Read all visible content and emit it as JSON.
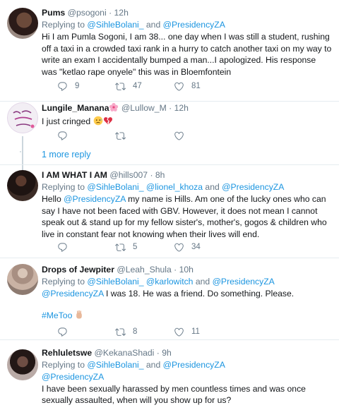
{
  "tweets": [
    {
      "name": "Pums",
      "handle": "@psogoni",
      "dot": "·",
      "time": "12h",
      "reply_prefix": "Replying to ",
      "reply_mentions": [
        "@SihleBolani_",
        "@PresidencyZA"
      ],
      "reply_and": " and ",
      "text": "Hi I am Pumla Sogoni, I am 38... one day when I was still a student, rushing off a taxi in a crowded taxi rank in a hurry to catch another taxi on my way to write an exam I accidentally bumped a  man...I apologized. His response was \"ketlao rape onyele\" this was in Bloemfontein",
      "replies": "9",
      "retweets": "47",
      "likes": "81"
    },
    {
      "name": "Lungile_Manana",
      "handle": "@Lullow_M",
      "dot": "·",
      "time": "12h",
      "text": "I just cringed",
      "more_replies": "1 more reply"
    },
    {
      "name": "I AM WHAT I AM",
      "handle": "@hills007",
      "dot": "·",
      "time": "8h",
      "reply_prefix": "Replying to ",
      "reply_mentions": [
        "@SihleBolani_",
        "@lionel_khoza",
        "@PresidencyZA"
      ],
      "reply_and": " and ",
      "text_hello": "Hello ",
      "text_mention": "@PresidencyZA",
      "text_rest": " my name is Hills. Am one of the lucky ones who can say I have not been faced with GBV. However, it does not mean I cannot speak out & stand up for my fellow sister's, mother's, gogos & children who live in constant fear not knowing when their lives will end.",
      "retweets": "5",
      "likes": "34"
    },
    {
      "name": "Drops of Jewpiter",
      "handle": "@Leah_Shula",
      "dot": "·",
      "time": "10h",
      "reply_prefix": "Replying to ",
      "reply_mentions": [
        "@SihleBolani_",
        "@karlowitch",
        "@PresidencyZA"
      ],
      "reply_and": " and ",
      "text_mention": "@PresidencyZA",
      "text_rest": " I was 18. He was a friend. Do something. Please.",
      "hashtag": "#MeToo",
      "retweets": "8",
      "likes": "11"
    },
    {
      "name": "Rehluletswe",
      "handle": "@KekanaShadi",
      "dot": "·",
      "time": "9h",
      "reply_prefix": "Replying to ",
      "reply_mentions": [
        "@SihleBolani_",
        "@PresidencyZA"
      ],
      "reply_and": " and ",
      "text_mention": "@PresidencyZA",
      "text_rest": "I have been sexually harassed by men countless times and was once sexually assaulted, when will you show up for us?"
    }
  ],
  "colors": {
    "link": "#1b95e0",
    "secondary": "#657786",
    "divider": "#e6ecf0",
    "thread_line": "#ccd6dd"
  },
  "icons": [
    "reply-icon",
    "retweet-icon",
    "like-icon",
    "more-icon"
  ]
}
